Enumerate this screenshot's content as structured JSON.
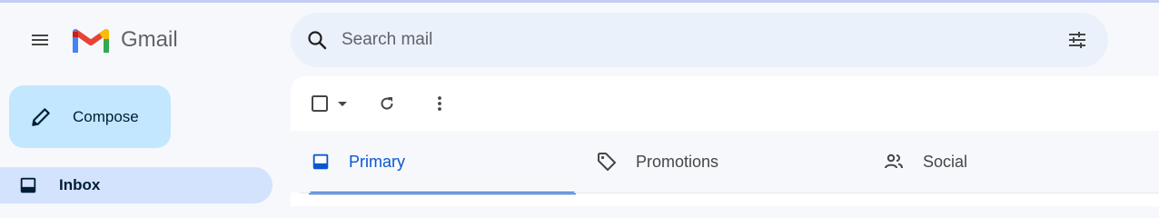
{
  "app": {
    "logo_text": "Gmail",
    "icons": {
      "menu": "hamburger-menu-icon",
      "logo": "gmail-m-logo-icon"
    }
  },
  "search": {
    "placeholder": "Search mail",
    "icons": {
      "search": "search-icon",
      "filter": "filter-options-icon"
    }
  },
  "sidebar": {
    "compose_label": "Compose",
    "compose_icon": "pencil-icon",
    "items": [
      {
        "label": "Inbox",
        "icon": "inbox-icon",
        "selected": true
      }
    ]
  },
  "toolbar": {
    "icons": [
      "select-checkbox-icon",
      "dropdown-arrow-icon",
      "refresh-icon",
      "more-vert-icon"
    ]
  },
  "tabs": [
    {
      "label": "Primary",
      "icon": "inbox-icon",
      "selected": true
    },
    {
      "label": "Promotions",
      "icon": "tag-icon",
      "selected": false
    },
    {
      "label": "Social",
      "icon": "people-icon",
      "selected": false
    }
  ],
  "colors": {
    "background": "#f6f8fc",
    "compose_bg": "#c2e7ff",
    "selected_bg": "#d3e3fd",
    "accent": "#0b57d0",
    "search_bg": "#eaf1fb"
  }
}
